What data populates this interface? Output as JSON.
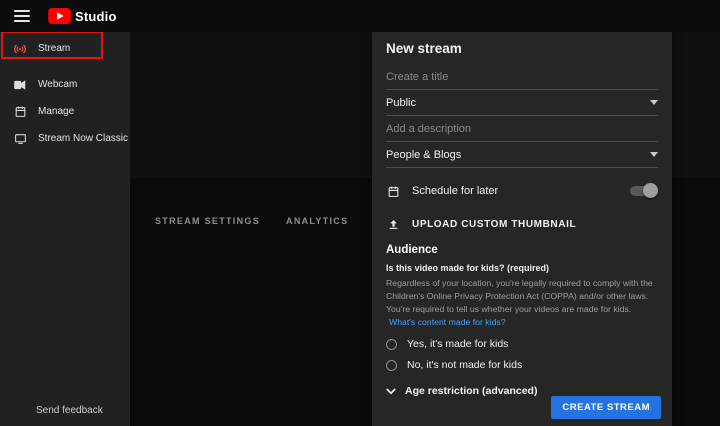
{
  "topbar": {
    "brand": "Studio"
  },
  "sidebar": {
    "items": [
      {
        "label": "Stream"
      },
      {
        "label": "Webcam"
      },
      {
        "label": "Manage"
      },
      {
        "label": "Stream Now Classic"
      }
    ],
    "feedback": "Send feedback"
  },
  "main": {
    "tabs": [
      "STREAM SETTINGS",
      "ANALYTICS"
    ]
  },
  "dialog": {
    "title": "New stream",
    "title_placeholder": "Create a title",
    "privacy_value": "Public",
    "description_placeholder": "Add a description",
    "category_value": "People & Blogs",
    "schedule_label": "Schedule for later",
    "upload_label": "UPLOAD CUSTOM THUMBNAIL",
    "audience_heading": "Audience",
    "kids_question": "Is this video made for kids? (required)",
    "kids_info": "Regardless of your location, you're legally required to comply with the Children's Online Privacy Protection Act (COPPA) and/or other laws. You're required to tell us whether your videos are made for kids.",
    "kids_link": "What's content made for kids?",
    "radio_yes": "Yes, it's made for kids",
    "radio_no": "No, it's not made for kids",
    "age_restriction": "Age restriction (advanced)",
    "create_button": "CREATE STREAM"
  },
  "colors": {
    "brand_red": "#ff0000",
    "highlight_red": "#e8120c",
    "link_blue": "#3ea6ff",
    "button_blue": "#2374e1"
  }
}
